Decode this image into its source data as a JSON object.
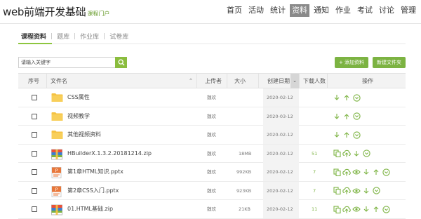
{
  "brand": {
    "title": "web前端开发基础",
    "subtitle": "课程门户"
  },
  "nav": [
    "首页",
    "活动",
    "统计",
    "资料",
    "通知",
    "作业",
    "考试",
    "讨论",
    "管理"
  ],
  "nav_active_index": 3,
  "subtabs": [
    "课程资料",
    "题库",
    "作业库",
    "试卷库"
  ],
  "search": {
    "placeholder": "请输入关键字"
  },
  "buttons": {
    "add": "+ 添加资料",
    "new_folder": "新建文件夹"
  },
  "columns": [
    "序号",
    "文件名",
    "上传者",
    "大小",
    "创建日期",
    "下载人数",
    "操作"
  ],
  "rows": [
    {
      "type": "folder",
      "name": "CSS属性",
      "uploader": "魏欢",
      "size": "",
      "date": "2020-02-12",
      "downloads": "",
      "ops": [
        "download",
        "up",
        "more"
      ]
    },
    {
      "type": "folder",
      "name": "视频教学",
      "uploader": "魏欢",
      "size": "",
      "date": "2020-03-12",
      "downloads": "",
      "ops": [
        "download",
        "up",
        "more"
      ]
    },
    {
      "type": "folder",
      "name": "其他视频资料",
      "uploader": "魏欢",
      "size": "",
      "date": "2020-02-12",
      "downloads": "",
      "ops": [
        "download",
        "up",
        "more"
      ]
    },
    {
      "type": "zip",
      "name": "HBuilderX.1.3.2.20181214.zip",
      "uploader": "魏欢",
      "size": "18MB",
      "date": "2020-02-12",
      "downloads": "51",
      "ops": [
        "copy",
        "upload",
        "download",
        "more"
      ]
    },
    {
      "type": "ppt",
      "name": "第1章HTML知识.pptx",
      "uploader": "魏欢",
      "size": "992KB",
      "date": "2020-02-12",
      "downloads": "7",
      "ops": [
        "copy",
        "upload",
        "view",
        "download",
        "up",
        "more"
      ]
    },
    {
      "type": "ppt",
      "name": "第2章CSS入门.pptx",
      "uploader": "魏欢",
      "size": "923KB",
      "date": "2020-02-12",
      "downloads": "7",
      "ops": [
        "copy",
        "upload",
        "view",
        "download",
        "more"
      ]
    },
    {
      "type": "zip",
      "name": "01.HTML基础.zip",
      "uploader": "魏欢",
      "size": "21KB",
      "date": "2020-02-12",
      "downloads": "11",
      "ops": [
        "copy",
        "upload",
        "view",
        "download",
        "up",
        "more"
      ]
    }
  ],
  "colors": {
    "accent": "#7cb342",
    "folder": "#f5c242",
    "ppt": "#e8773a",
    "zip": "#7cb342"
  }
}
